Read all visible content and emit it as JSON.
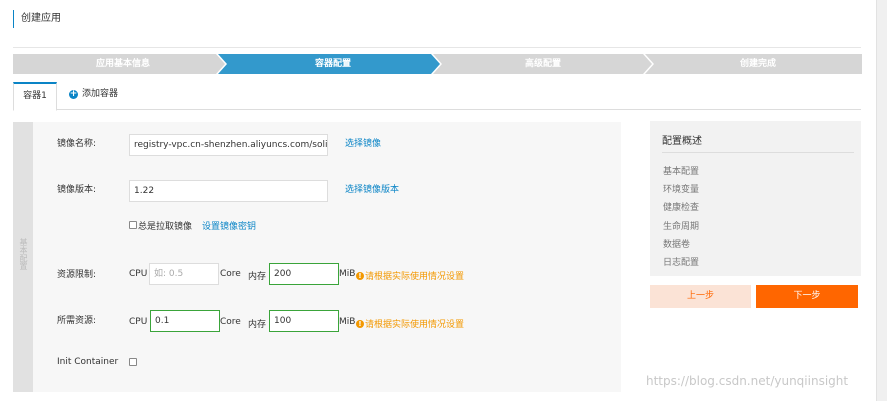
{
  "page": {
    "title": "创建应用"
  },
  "steps": [
    {
      "label": "应用基本信息",
      "state": "done"
    },
    {
      "label": "容器配置",
      "state": "active"
    },
    {
      "label": "高级配置",
      "state": "pending"
    },
    {
      "label": "创建完成",
      "state": "pending"
    }
  ],
  "step_colors": {
    "done": "#d6d6d6",
    "active": "#3399cc",
    "pending": "#d6d6d6"
  },
  "tabs": {
    "active": "容器1",
    "add_label": "添加容器",
    "add_icon": "plus-circle-icon"
  },
  "form": {
    "side_label": "基本配置",
    "image_name": {
      "label": "镜像名称:",
      "value": "registry-vpc.cn-shenzhen.aliyuncs.com/solinx/",
      "link": "选择镜像"
    },
    "image_version": {
      "label": "镜像版本:",
      "value": "1.22",
      "link": "选择镜像版本"
    },
    "always_pull": {
      "label": "总是拉取镜像",
      "link": "设置镜像密钥"
    },
    "resource_limit": {
      "label": "资源限制:",
      "cpu_label": "CPU",
      "cpu_placeholder": "如: 0.5",
      "cpu_unit": "Core",
      "mem_label": "内存",
      "mem_value": "200",
      "mem_unit": "MiB",
      "hint": "请根据实际使用情况设置"
    },
    "resource_request": {
      "label": "所需资源:",
      "cpu_label": "CPU",
      "cpu_value": "0.1",
      "cpu_unit": "Core",
      "mem_label": "内存",
      "mem_value": "100",
      "mem_unit": "MiB",
      "hint": "请根据实际使用情况设置"
    },
    "init_container": {
      "label": "Init Container"
    }
  },
  "summary": {
    "title": "配置概述",
    "items": [
      "基本配置",
      "环境变量",
      "健康检查",
      "生命周期",
      "数据卷",
      "日志配置"
    ]
  },
  "buttons": {
    "prev": "上一步",
    "next": "下一步"
  },
  "colors": {
    "accent": "#0a84c6",
    "primary_button": "#ff6600",
    "warning": "#f39800",
    "valid_border": "#3aa43a"
  },
  "watermark": "https://blog.csdn.net/yunqiinsight"
}
